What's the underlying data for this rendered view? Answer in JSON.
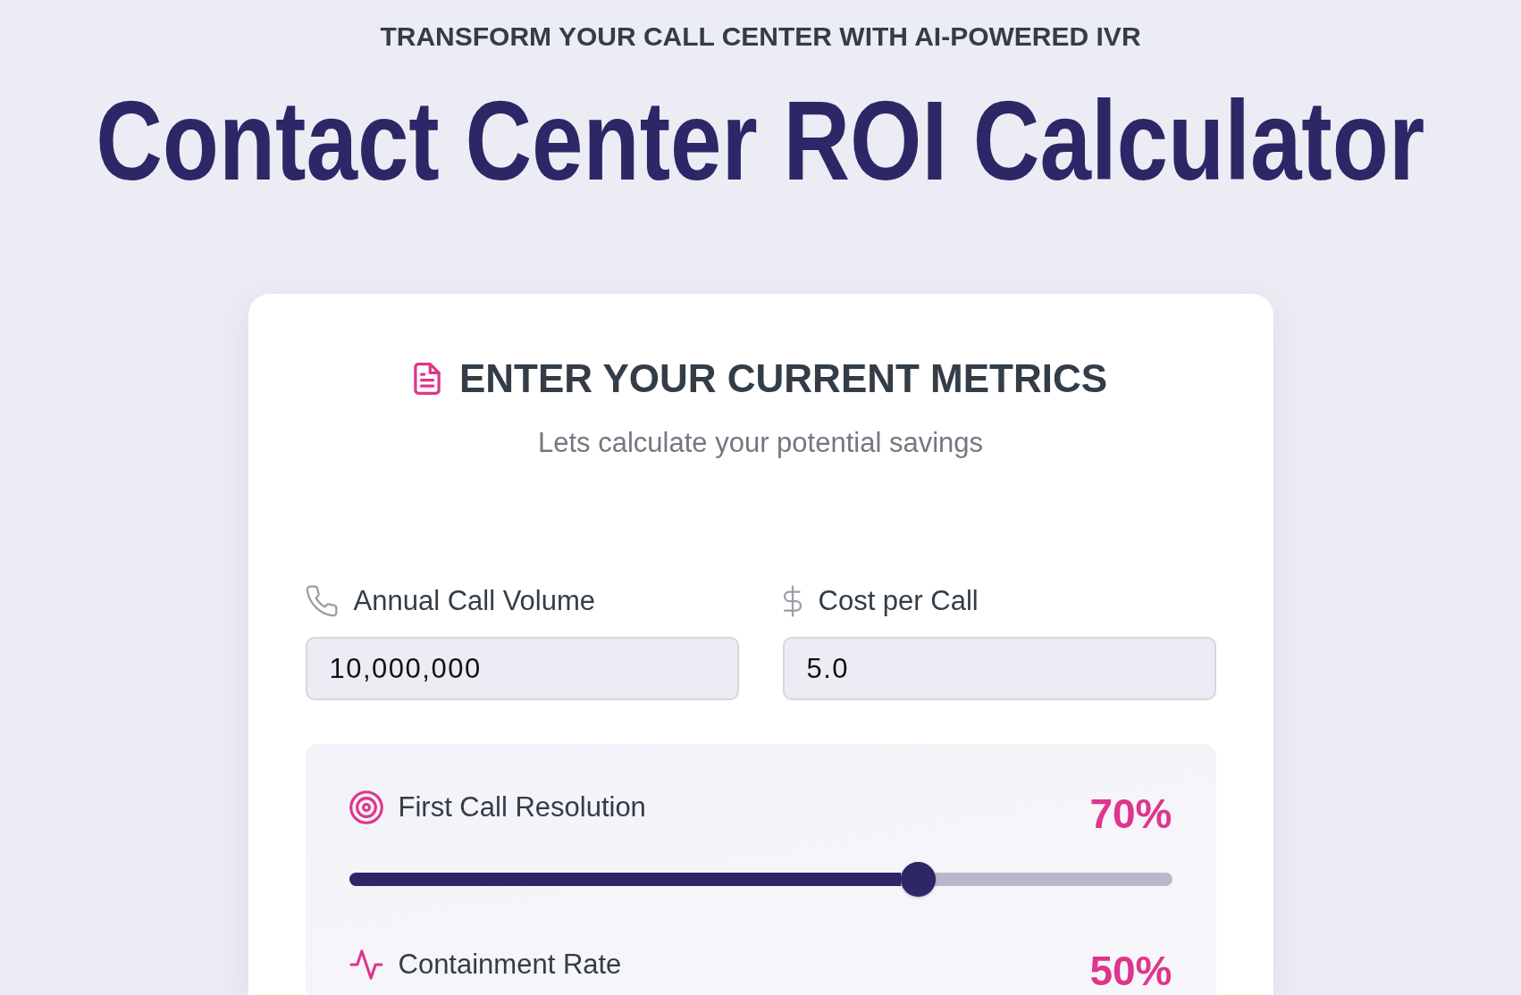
{
  "header": {
    "eyebrow": "TRANSFORM YOUR CALL CENTER WITH AI-POWERED IVR",
    "title": "Contact Center ROI Calculator"
  },
  "card": {
    "heading": "ENTER YOUR CURRENT METRICS",
    "subtitle": "Lets calculate your potential savings",
    "fields": [
      {
        "label": "Annual Call Volume",
        "value": "10,000,000"
      },
      {
        "label": "Cost per Call",
        "value": "5.0"
      }
    ],
    "sliders": [
      {
        "label": "First Call Resolution",
        "reading": "70%",
        "level": 0.7
      },
      {
        "label": "Containment Rate",
        "reading": "50%"
      }
    ]
  }
}
